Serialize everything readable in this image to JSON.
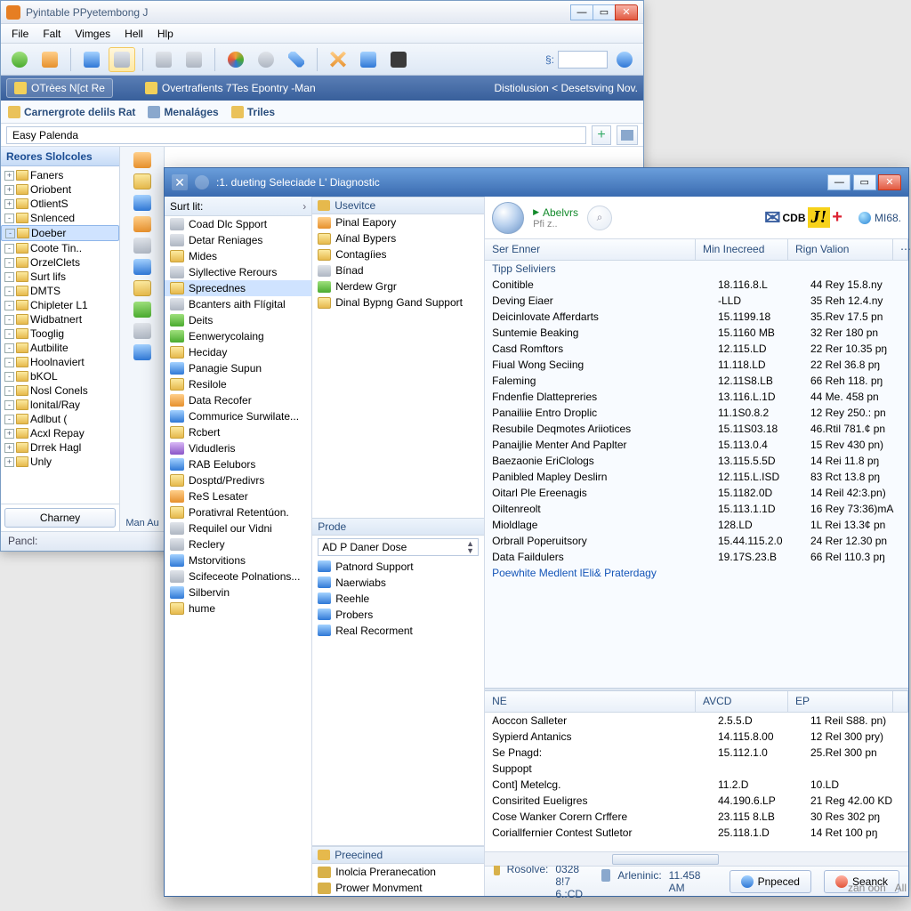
{
  "bg": {
    "title": "Pyintable PPyetembong J",
    "menu": [
      "File",
      "Falt",
      "Vimges",
      "Hell",
      "Hlp"
    ],
    "tab1": "OTrèes N[ct Re",
    "tab2": "Overtrafients 7Tes Epontry -Man",
    "right_tab": "Distiolusion < Desetsving Nov.",
    "crumbs": [
      "Carnergrote delils Rat",
      "Menaláges",
      "Triles"
    ],
    "addr": "Easy Palenda",
    "tree_hdr": "Reores Slolcoles",
    "tree": [
      "Faners",
      "Oriobent",
      "OtlientS",
      "Snlenced",
      "Doeber",
      "Coote Tin..",
      "OrzelClets",
      "Surt lifs",
      "DMTS",
      "Chipleter L1",
      "Widbatnert",
      "Tooglig",
      "Autbilite",
      "Hoolnaviert",
      "bKOL",
      "Nosl Conels",
      "lonital/Ray",
      "Adlbut (",
      "Acxl Repay",
      "Drrek Hagl",
      "Unly"
    ],
    "tree_sel": 4,
    "charney": "Charney",
    "status": "Pancl:",
    "mid_lbl": "Man Au"
  },
  "fg": {
    "title": ":1. dueting Seleciade L' Diagnostic",
    "colA_hdr": "Surt lit:",
    "colA": [
      "Coad Dlc Spport",
      "Detar Reniages",
      "Mides",
      "Siyllective Rerours",
      "Sprecednes",
      "Bcanters aith Flígital",
      "Deits",
      "Eenwerycolaing",
      "Heciday",
      "Panagie Supun",
      "Resilole",
      "Data Recofer",
      "Commurice Surwilate...",
      "Rcbert",
      "Vidudleris",
      "RAB Eelubors",
      "Dosptd/Predivrs",
      "ReS Lesater",
      "Porativral Retentúon.",
      "Requilel our Vidni",
      "Reclery",
      "Mstorvitions",
      "Scifeceote Polnations...",
      "Silbervin",
      "hume"
    ],
    "colA_sel": 4,
    "paneB1_hdr": "Usevitce",
    "paneB1": [
      "Pinal Eapory",
      "Aínal Bypers",
      "Contagíies",
      "Bínad",
      "Nerdew Grgr",
      "Dinal Bypng Gand Support"
    ],
    "paneB2_hdr": "Prode",
    "paneB2_spin": "AD P Daner Dose",
    "paneB2": [
      "Patnord Support",
      "Naerwiabs",
      "Reehle",
      "Probers",
      "Real Recorment"
    ],
    "paneB3_hdr": "Preecined",
    "paneB3": [
      "Inolcia Preranecation",
      "Prower Monvment"
    ],
    "abel": "Abelvrs",
    "pi": "Pfi z..",
    "brand": "CDB",
    "m68": "MI68.",
    "grid1": {
      "cols": [
        "Ser Enner",
        "Min Inecreed",
        "Rign Valion"
      ],
      "hd": "Tipp Seliviers",
      "rows": [
        [
          "Conitible",
          "18.116.8.L",
          "44 Rey 15.8.ny"
        ],
        [
          "Deving Eiaer",
          "-LLD",
          "35 Reh 12.4.ny"
        ],
        [
          "Deicinlovate Afferdarts",
          "15.1199.18",
          "35.Rev 17.5 pn"
        ],
        [
          "Suntemie Beaking",
          "15.1160 MB",
          "32 Rer 180 pn"
        ],
        [
          "Casd Romftors",
          "12.115.LD",
          "22 Rer 10.35 pŋ"
        ],
        [
          "Fiual Wong Seciing",
          "11.118.LD",
          "22 Rel 36.8 pŋ"
        ],
        [
          "Faleming",
          "12.11S8.LB",
          "66 Reh 118. pŋ"
        ],
        [
          "Fndenfie Dlattepreries",
          "13.116.L.1D",
          "44 Me. 458 pn"
        ],
        [
          "Panailiie Entro Droplic",
          "11.1S0.8.2",
          "12 Rey 250.: pn"
        ],
        [
          "Resubile Deqmotes Ariiotices",
          "15.11S03.18",
          "46.Rtil 781.¢ pn"
        ],
        [
          "Panaijlie Menter And Paplter",
          "15.113.0.4",
          "15 Rev 430 pn)"
        ],
        [
          "Baezaonie EriClologs",
          "13.115.5.5D",
          "14 Rei 11.8 pŋ"
        ],
        [
          "Panibled Mapley Deslirn",
          "12.115.L.ISD",
          "83 Rct 13.8 pŋ"
        ],
        [
          "Oitarl Ple Ereenagis",
          "15.1182.0D",
          "14 Reil 42:3.pn)"
        ],
        [
          "Oiltenreolt",
          "15.113.1.1D",
          "16 Rey 73:36)mA"
        ],
        [
          "Mioldlage",
          "128.LD",
          "1L Rei 13.3¢ pn"
        ],
        [
          "Orbrall Poperuitsory",
          "15.44.115.2.0",
          "24 Rer 12.30 pn"
        ],
        [
          "Data Faildulers",
          "19.17S.23.B",
          "66 Rel 110.3 pŋ"
        ]
      ],
      "link": "Poewhite Medlent lEli& Praterdagy"
    },
    "grid2": {
      "cols": [
        "NE",
        "AVCD",
        "EP"
      ],
      "rows": [
        [
          "Aoccon Salleter",
          "2.5.5.D",
          "11 Reil S88. pn)"
        ],
        [
          "Sypierd Antanics",
          "14.115.8.00",
          "12 Rel 300 pry)"
        ],
        [
          "Se Pnagd:",
          "15.112.1.0",
          "25.Rel 300 pn"
        ],
        [
          "Suppopt",
          "",
          ""
        ],
        [
          "Cont] Metelcg.",
          "11.2.D",
          "10.LD"
        ],
        [
          "Consirited Eueligres",
          "44.190.6.LP",
          "21 Reg 42.00 KD"
        ],
        [
          "Cose Wanker Corern Crffere",
          "23.115 8.LB",
          "30 Res 302 pŋ"
        ],
        [
          "Coriallfernier Contest Sutletor",
          "25.118.1.D",
          "14 Ret 100 pŋ"
        ]
      ]
    },
    "foot": {
      "k1": "Rosolve:",
      "v1": "0328 8!7 6.:CD",
      "k2": "Arleninic:",
      "v2": "11.458 AM",
      "b1": "Pnpeced",
      "b2": "Seanck"
    },
    "corner": [
      "zan oon",
      "All"
    ]
  }
}
